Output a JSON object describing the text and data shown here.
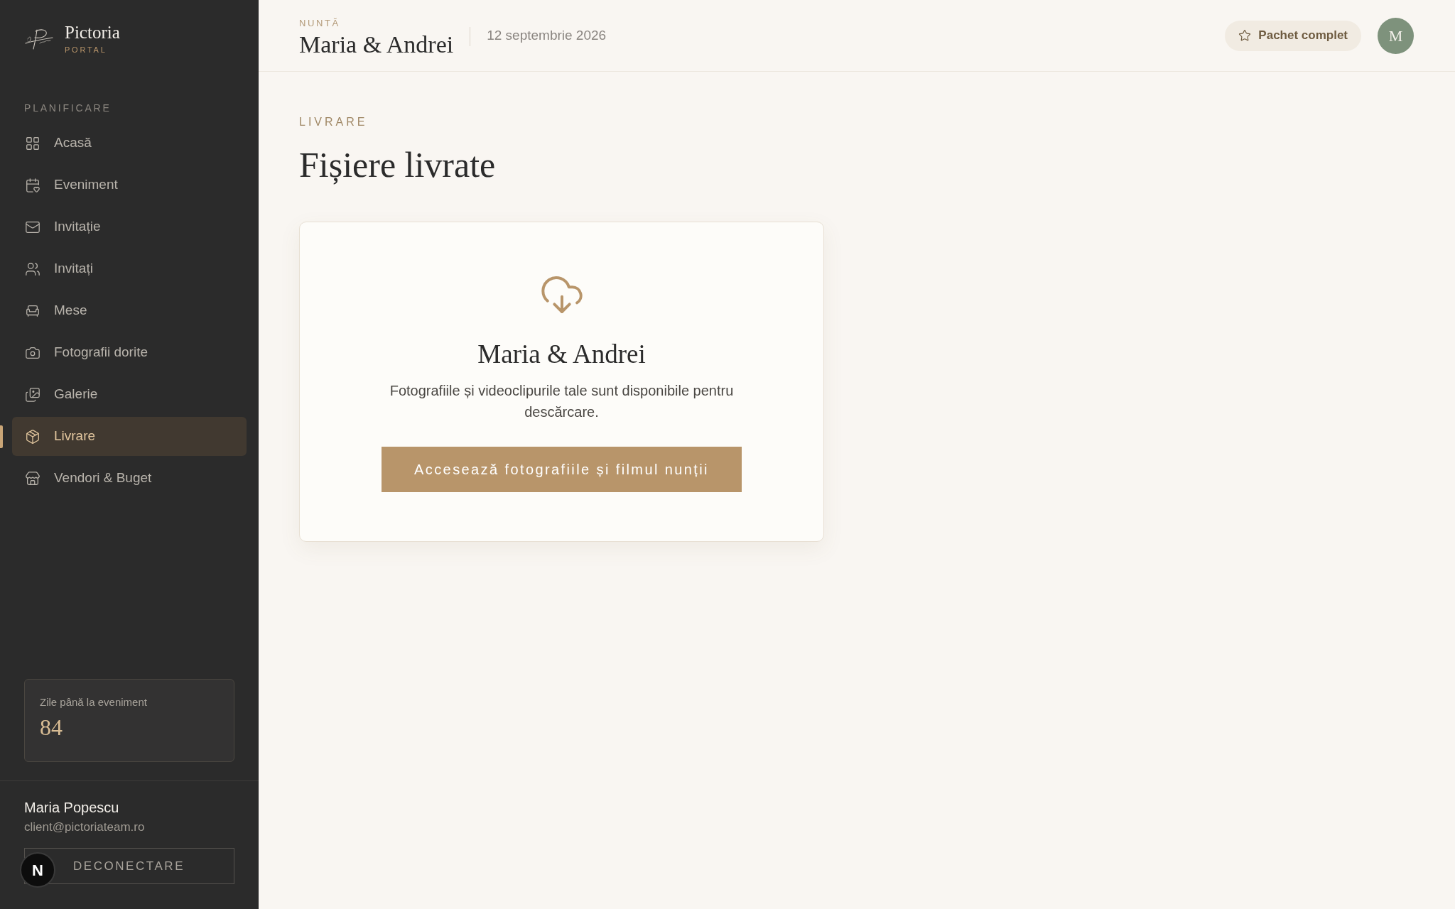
{
  "sidebar": {
    "brand": {
      "name": "Pictoria",
      "subtitle": "PORTAL"
    },
    "section_label": "PLANIFICARE",
    "items": [
      {
        "label": "Acasă",
        "selected": false
      },
      {
        "label": "Eveniment",
        "selected": false
      },
      {
        "label": "Invitație",
        "selected": false
      },
      {
        "label": "Invitați",
        "selected": false
      },
      {
        "label": "Mese",
        "selected": false
      },
      {
        "label": "Fotografii dorite",
        "selected": false
      },
      {
        "label": "Galerie",
        "selected": false
      },
      {
        "label": "Livrare",
        "selected": true
      },
      {
        "label": "Vendori & Buget",
        "selected": false
      }
    ],
    "countdown": {
      "label": "Zile până la eveniment",
      "value": "84"
    },
    "user": {
      "name": "Maria Popescu",
      "email": "client@pictoriateam.ro",
      "logout": "DECONECTARE"
    }
  },
  "dev_badge": {
    "label": "N"
  },
  "header": {
    "eyebrow": "NUNTĂ",
    "title": "Maria & Andrei",
    "date": "12 septembrie 2026",
    "plan_badge": "Pachet complet",
    "avatar": "M"
  },
  "page": {
    "eyebrow": "LIVRARE",
    "title": "Fișiere livrate"
  },
  "delivery_card": {
    "title": "Maria & Andrei",
    "description": "Fotografiile și videoclipurile tale sunt disponibile pentru descărcare.",
    "button": "Accesează fotografiile și filmul nunții"
  }
}
